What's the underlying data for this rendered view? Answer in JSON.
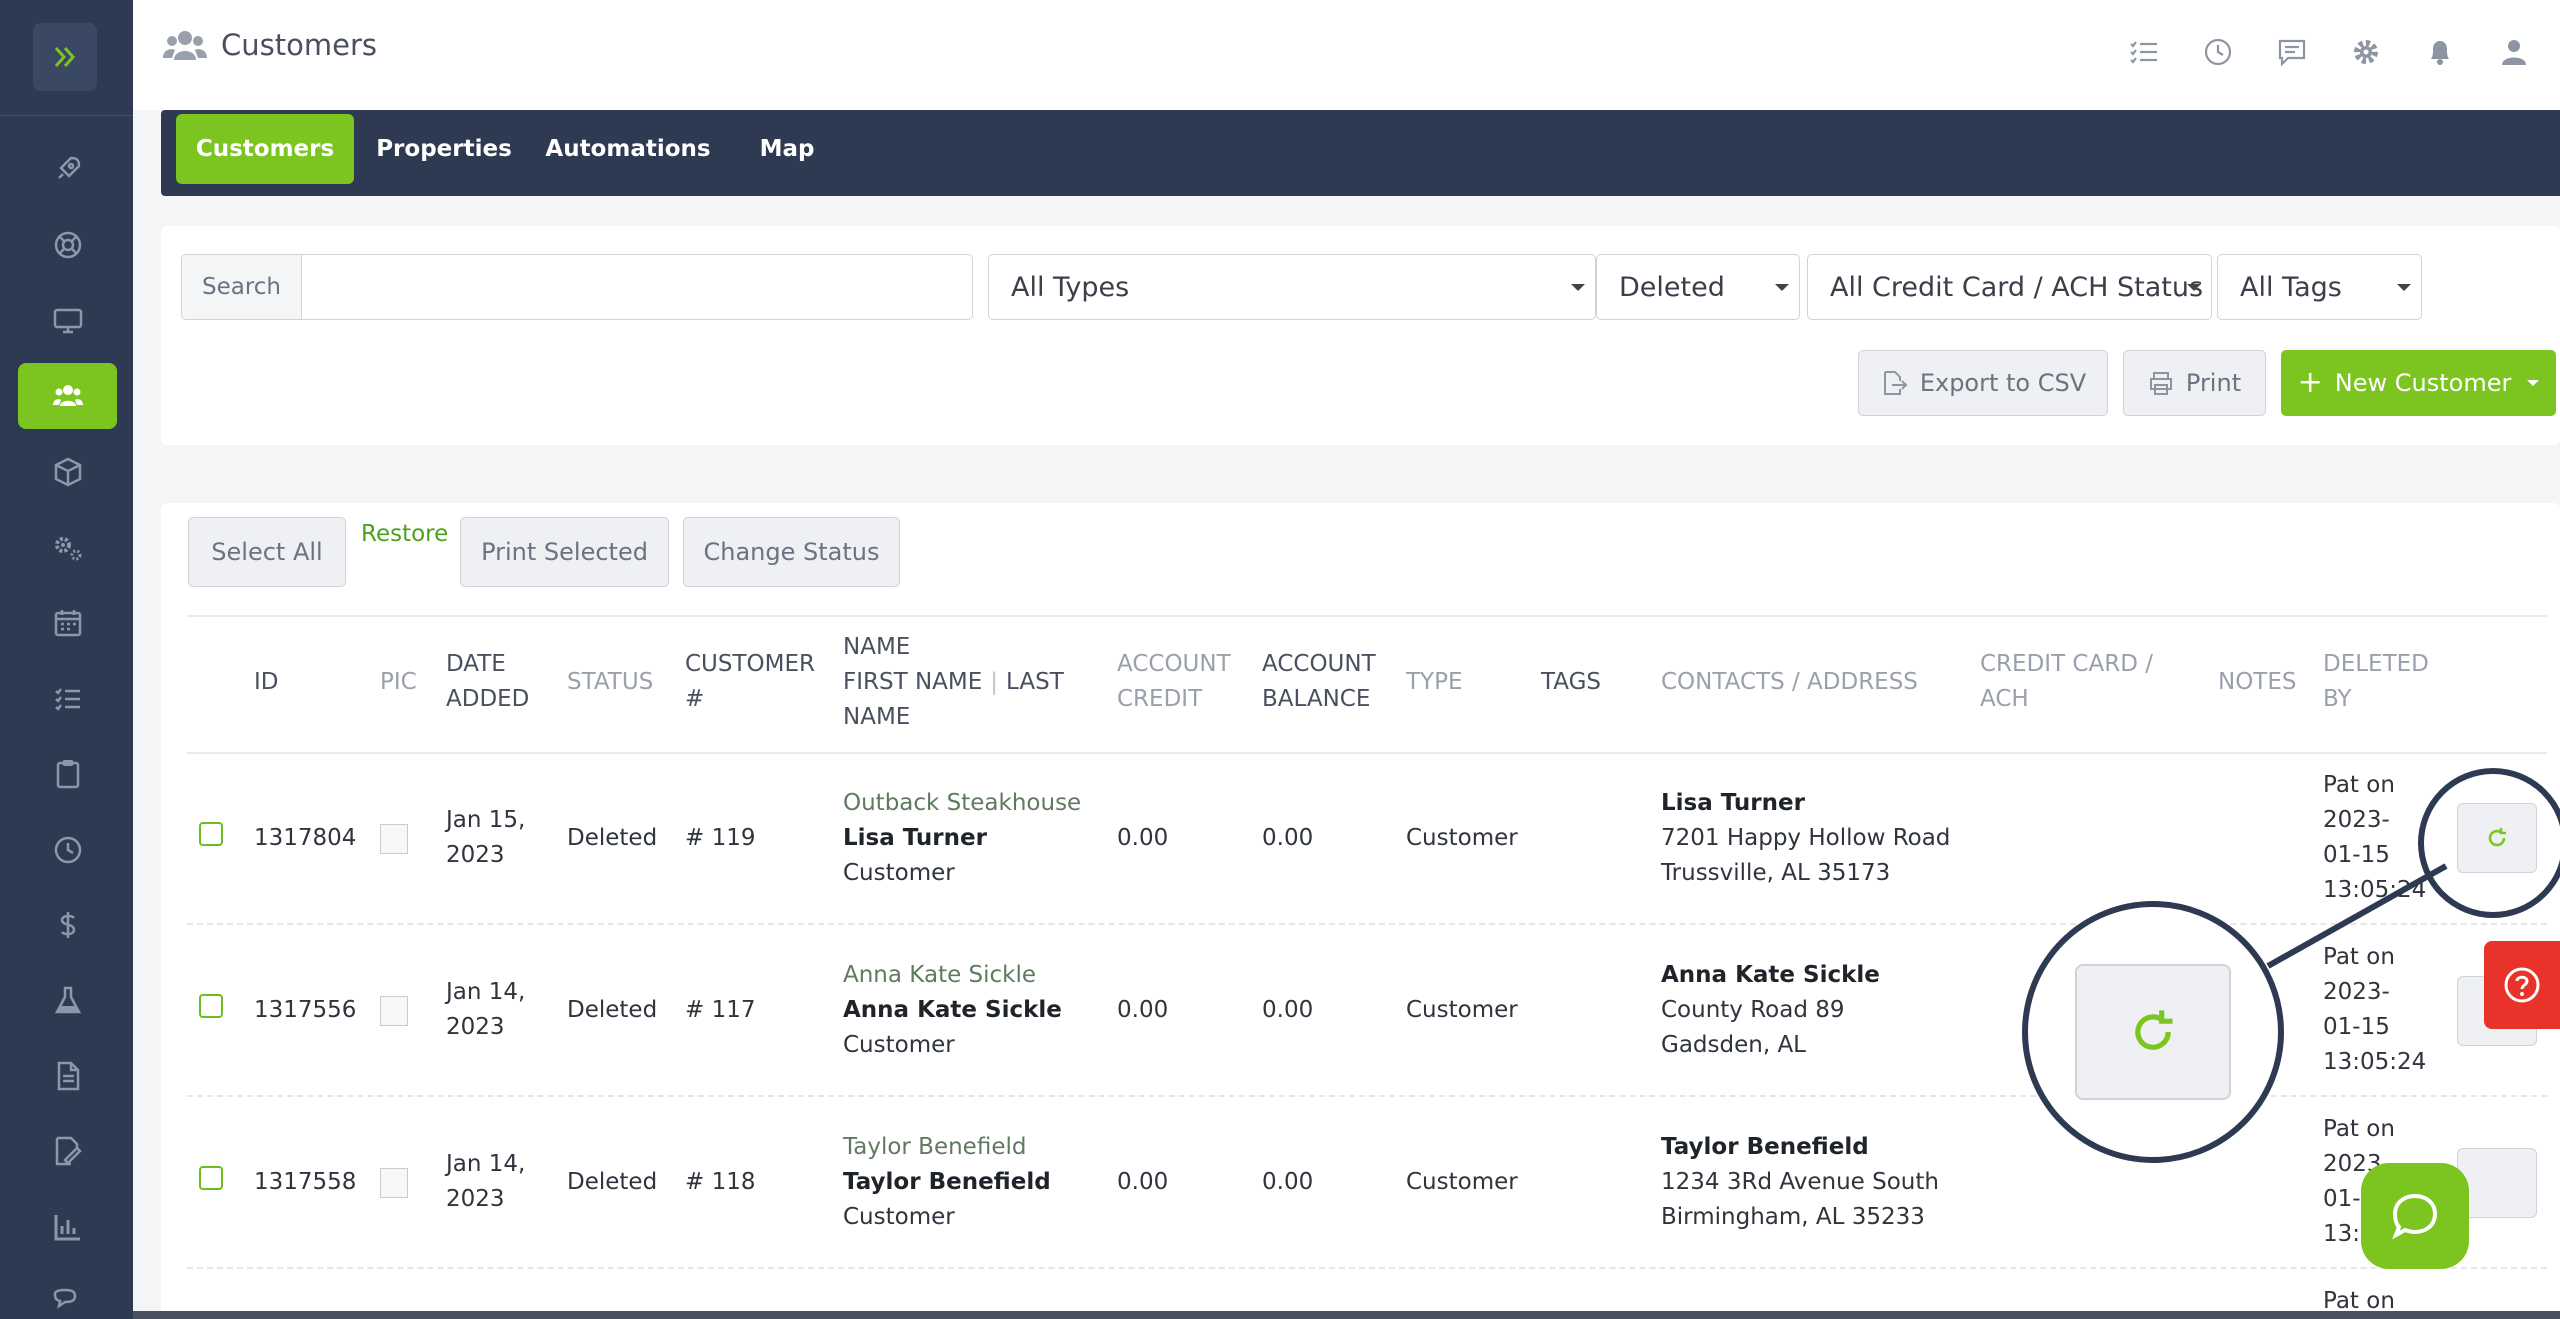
{
  "header": {
    "title": "Customers",
    "icons": [
      "tasks-icon",
      "clock-icon",
      "chat-icon",
      "gear-icon",
      "bell-icon",
      "user-icon"
    ]
  },
  "sidebar": {
    "items": [
      {
        "icon": "rocket-icon"
      },
      {
        "icon": "lifebuoy-icon"
      },
      {
        "icon": "monitor-icon"
      },
      {
        "icon": "users-icon",
        "active": true
      },
      {
        "icon": "box-icon"
      },
      {
        "icon": "gears-icon"
      },
      {
        "icon": "calendar-icon"
      },
      {
        "icon": "list-icon"
      },
      {
        "icon": "clipboard-icon"
      },
      {
        "icon": "clock-icon"
      },
      {
        "icon": "dollar-icon"
      },
      {
        "icon": "flask-icon"
      },
      {
        "icon": "document-icon"
      },
      {
        "icon": "signature-icon"
      },
      {
        "icon": "chart-icon"
      },
      {
        "icon": "comments-icon"
      }
    ]
  },
  "tabs": [
    {
      "label": "Customers",
      "active": true
    },
    {
      "label": "Properties"
    },
    {
      "label": "Automations"
    },
    {
      "label": "Map"
    }
  ],
  "filters": {
    "search_label": "Search",
    "search_value": "",
    "type_select": "All Types",
    "status_select": "Deleted",
    "cc_select": "All Credit Card / ACH Status",
    "tags_select": "All Tags",
    "export_label": "Export to CSV",
    "print_label": "Print",
    "new_customer_label": "New Customer"
  },
  "bulk": {
    "select_all": "Select All",
    "restore": "Restore",
    "print_selected": "Print Selected",
    "change_status": "Change Status"
  },
  "columns": {
    "id": "ID",
    "pic": "PIC",
    "date_added_1": "DATE",
    "date_added_2": "ADDED",
    "status": "STATUS",
    "customer_1": "CUSTOMER",
    "customer_2": "#",
    "name_1": "NAME",
    "name_2": "FIRST NAME",
    "name_3": "LAST",
    "name_4": "NAME",
    "account_credit_1": "ACCOUNT",
    "account_credit_2": "CREDIT",
    "account_balance_1": "ACCOUNT",
    "account_balance_2": "BALANCE",
    "type": "TYPE",
    "tags": "TAGS",
    "contacts": "CONTACTS / ADDRESS",
    "cc_1": "CREDIT CARD /",
    "cc_2": "ACH",
    "notes": "NOTES",
    "deleted_by_1": "DELETED",
    "deleted_by_2": "BY"
  },
  "rows": [
    {
      "id": "1317804",
      "date_1": "Jan 15,",
      "date_2": "2023",
      "status": "Deleted",
      "customer_no": "# 119",
      "company": "Outback Steakhouse",
      "name": "Lisa Turner",
      "role": "Customer",
      "account_credit": "0.00",
      "account_balance": "0.00",
      "type": "Customer",
      "contact_name": "Lisa Turner",
      "address_1": "7201 Happy Hollow Road",
      "address_2": "Trussville, AL 35173",
      "deleted_1": "Pat on",
      "deleted_2": "2023-",
      "deleted_3": "01-15",
      "deleted_4": "13:05:24"
    },
    {
      "id": "1317556",
      "date_1": "Jan 14,",
      "date_2": "2023",
      "status": "Deleted",
      "customer_no": "# 117",
      "company": "Anna Kate Sickle",
      "name": "Anna Kate Sickle",
      "role": "Customer",
      "account_credit": "0.00",
      "account_balance": "0.00",
      "type": "Customer",
      "contact_name": "Anna Kate Sickle",
      "address_1": "County Road 89",
      "address_2": "Gadsden, AL",
      "deleted_1": "Pat on",
      "deleted_2": "2023-",
      "deleted_3": "01-15",
      "deleted_4": "13:05:24"
    },
    {
      "id": "1317558",
      "date_1": "Jan 14,",
      "date_2": "2023",
      "status": "Deleted",
      "customer_no": "# 118",
      "company": "Taylor Benefield",
      "name": "Taylor Benefield",
      "role": "Customer",
      "account_credit": "0.00",
      "account_balance": "0.00",
      "type": "Customer",
      "contact_name": "Taylor Benefield",
      "address_1": "1234 3Rd Avenue South",
      "address_2": "Birmingham, AL 35233",
      "deleted_1": "Pat on",
      "deleted_2": "2023-",
      "deleted_3": "01-15",
      "deleted_4": "13:05:24"
    }
  ],
  "partial_row": {
    "deleted_1": "Pat on"
  },
  "colors": {
    "accent": "#7cc520",
    "navy": "#2d3a52",
    "danger": "#e8322a"
  }
}
